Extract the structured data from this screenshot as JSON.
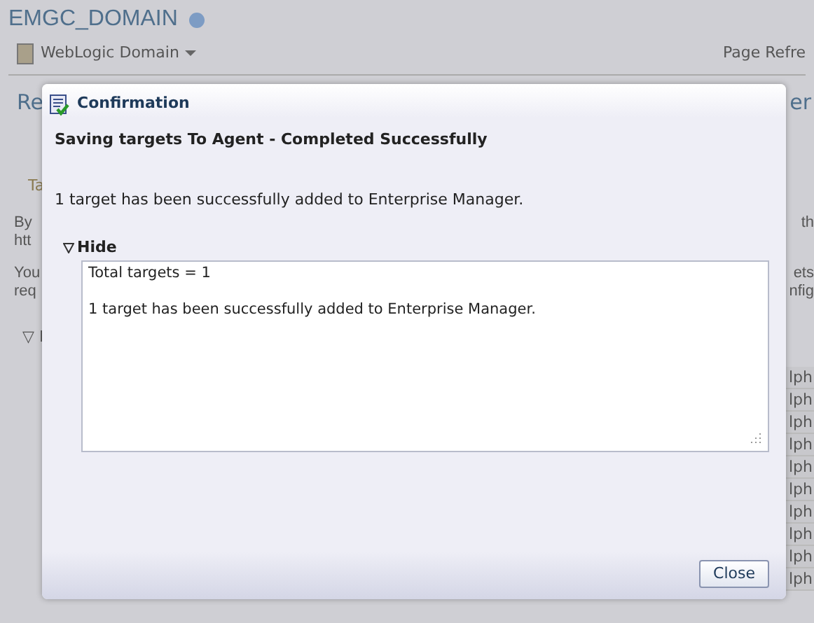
{
  "page": {
    "title": "EMGC_DOMAIN",
    "target_menu": "WebLogic Domain",
    "page_refresh": "Page Refre",
    "section_heading_left": "Re",
    "section_heading_right": "er",
    "tab_fragment": "Ta",
    "text_left": [
      "By",
      "htt"
    ],
    "text_right": [
      "th"
    ],
    "text2_left": [
      "You",
      "req"
    ],
    "text2_right": [
      "ets",
      "nfig"
    ],
    "disclosure_fragment": "▽ I",
    "host_cells": [
      "lph",
      "lph",
      "lph",
      "lph",
      "lph",
      "lph",
      "lph",
      "lph",
      "lph",
      "lph"
    ]
  },
  "dialog": {
    "title": "Confirmation",
    "heading": "Saving targets To Agent - Completed Successfully",
    "message": "1 target has been successfully added to Enterprise Manager.",
    "details": {
      "label": "Hide",
      "expanded": true,
      "lines": [
        "Total targets = 1",
        "1 target has been successfully added to Enterprise Manager."
      ]
    },
    "close_button": "Close"
  }
}
